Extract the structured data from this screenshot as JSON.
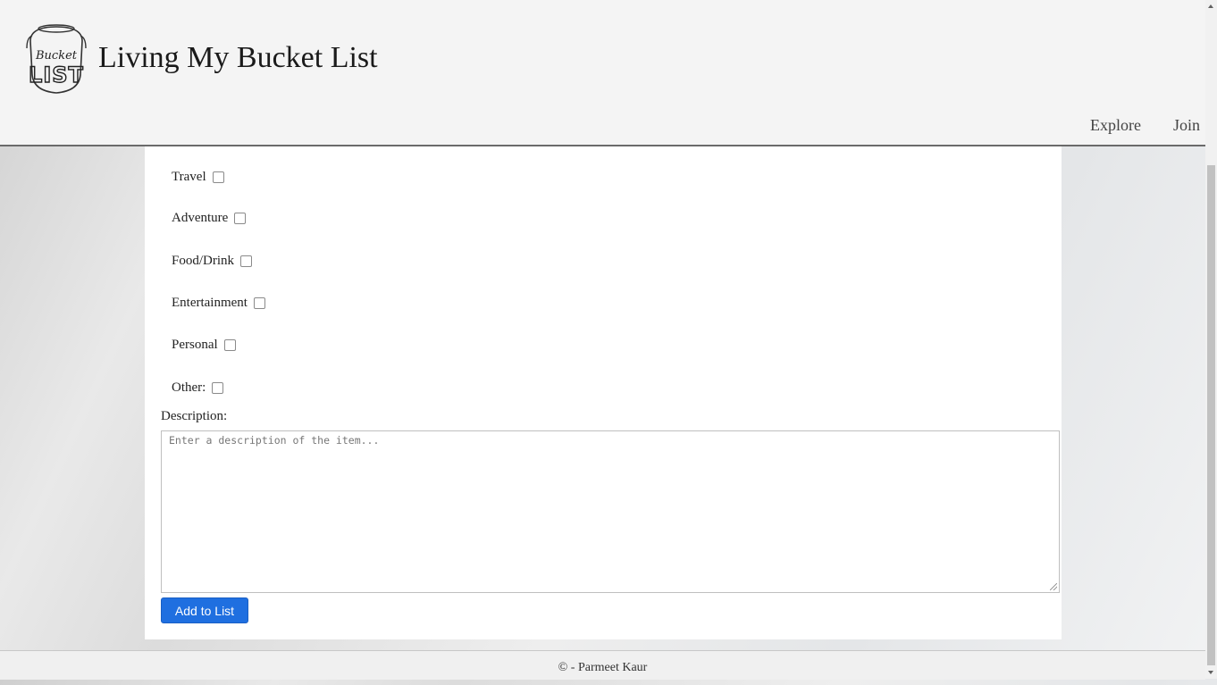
{
  "header": {
    "site_title": "Living My Bucket List",
    "logo_text_top": "Bucket",
    "logo_text_bottom": "LIST",
    "nav": {
      "explore": "Explore",
      "join": "Join"
    }
  },
  "form": {
    "categories": [
      {
        "label": "Travel",
        "checked": false
      },
      {
        "label": "Adventure",
        "checked": false
      },
      {
        "label": "Food/Drink",
        "checked": false
      },
      {
        "label": "Entertainment",
        "checked": false
      },
      {
        "label": "Personal",
        "checked": false
      },
      {
        "label": "Other:",
        "checked": false
      }
    ],
    "description_label": "Description:",
    "description_placeholder": "Enter a description of the item...",
    "description_value": "",
    "submit_label": "Add to List",
    "submit_color": "#1f6fe0"
  },
  "footer": {
    "text": "© - Parmeet Kaur"
  }
}
